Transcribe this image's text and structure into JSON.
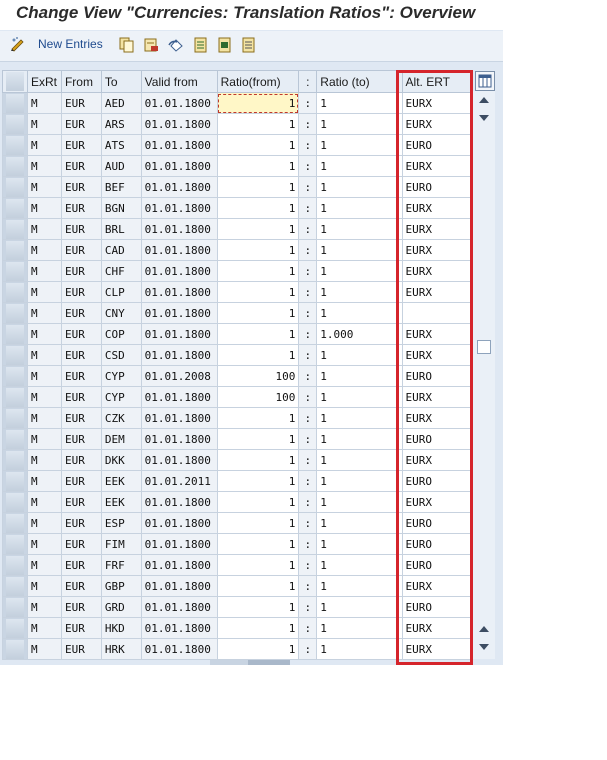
{
  "title": "Change View \"Currencies: Translation Ratios\": Overview",
  "toolbar": {
    "new_entries_label": "New Entries",
    "buttons": [
      "edit-icon",
      "copy-icon",
      "delete-icon",
      "undo-icon",
      "select-all-icon",
      "select-block-icon",
      "deselect-all-icon"
    ]
  },
  "table": {
    "headers": [
      "ExRt",
      "From",
      "To",
      "Valid from",
      "Ratio(from)",
      ":",
      "Ratio (to)",
      "Alt. ERT"
    ],
    "rows": [
      [
        "M",
        "EUR",
        "AED",
        "01.01.1800",
        "1",
        ":",
        "1",
        "EURX"
      ],
      [
        "M",
        "EUR",
        "ARS",
        "01.01.1800",
        "1",
        ":",
        "1",
        "EURX"
      ],
      [
        "M",
        "EUR",
        "ATS",
        "01.01.1800",
        "1",
        ":",
        "1",
        "EURO"
      ],
      [
        "M",
        "EUR",
        "AUD",
        "01.01.1800",
        "1",
        ":",
        "1",
        "EURX"
      ],
      [
        "M",
        "EUR",
        "BEF",
        "01.01.1800",
        "1",
        ":",
        "1",
        "EURO"
      ],
      [
        "M",
        "EUR",
        "BGN",
        "01.01.1800",
        "1",
        ":",
        "1",
        "EURX"
      ],
      [
        "M",
        "EUR",
        "BRL",
        "01.01.1800",
        "1",
        ":",
        "1",
        "EURX"
      ],
      [
        "M",
        "EUR",
        "CAD",
        "01.01.1800",
        "1",
        ":",
        "1",
        "EURX"
      ],
      [
        "M",
        "EUR",
        "CHF",
        "01.01.1800",
        "1",
        ":",
        "1",
        "EURX"
      ],
      [
        "M",
        "EUR",
        "CLP",
        "01.01.1800",
        "1",
        ":",
        "1",
        "EURX"
      ],
      [
        "M",
        "EUR",
        "CNY",
        "01.01.1800",
        "1",
        ":",
        "1",
        ""
      ],
      [
        "M",
        "EUR",
        "COP",
        "01.01.1800",
        "1",
        ":",
        "1.000",
        "EURX"
      ],
      [
        "M",
        "EUR",
        "CSD",
        "01.01.1800",
        "1",
        ":",
        "1",
        "EURX"
      ],
      [
        "M",
        "EUR",
        "CYP",
        "01.01.2008",
        "100",
        ":",
        "1",
        "EURO"
      ],
      [
        "M",
        "EUR",
        "CYP",
        "01.01.1800",
        "100",
        ":",
        "1",
        "EURX"
      ],
      [
        "M",
        "EUR",
        "CZK",
        "01.01.1800",
        "1",
        ":",
        "1",
        "EURX"
      ],
      [
        "M",
        "EUR",
        "DEM",
        "01.01.1800",
        "1",
        ":",
        "1",
        "EURO"
      ],
      [
        "M",
        "EUR",
        "DKK",
        "01.01.1800",
        "1",
        ":",
        "1",
        "EURX"
      ],
      [
        "M",
        "EUR",
        "EEK",
        "01.01.2011",
        "1",
        ":",
        "1",
        "EURO"
      ],
      [
        "M",
        "EUR",
        "EEK",
        "01.01.1800",
        "1",
        ":",
        "1",
        "EURX"
      ],
      [
        "M",
        "EUR",
        "ESP",
        "01.01.1800",
        "1",
        ":",
        "1",
        "EURO"
      ],
      [
        "M",
        "EUR",
        "FIM",
        "01.01.1800",
        "1",
        ":",
        "1",
        "EURO"
      ],
      [
        "M",
        "EUR",
        "FRF",
        "01.01.1800",
        "1",
        ":",
        "1",
        "EURO"
      ],
      [
        "M",
        "EUR",
        "GBP",
        "01.01.1800",
        "1",
        ":",
        "1",
        "EURX"
      ],
      [
        "M",
        "EUR",
        "GRD",
        "01.01.1800",
        "1",
        ":",
        "1",
        "EURO"
      ],
      [
        "M",
        "EUR",
        "HKD",
        "01.01.1800",
        "1",
        ":",
        "1",
        "EURX"
      ],
      [
        "M",
        "EUR",
        "HRK",
        "01.01.1800",
        "1",
        ":",
        "1",
        "EURX"
      ]
    ]
  },
  "highlight_color": "#d5242b"
}
